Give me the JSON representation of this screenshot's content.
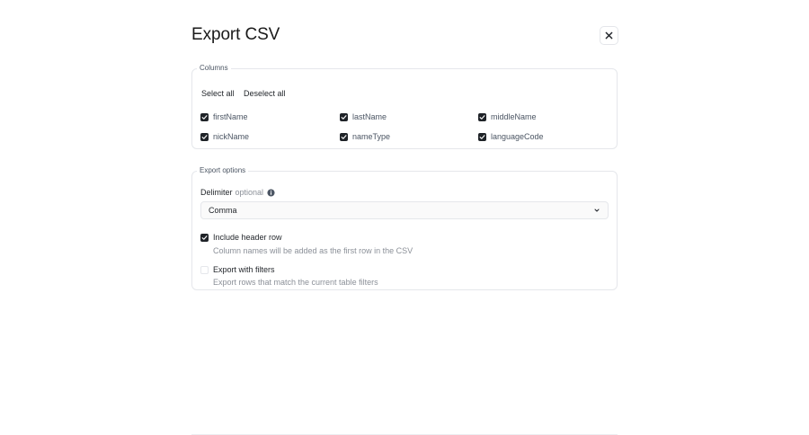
{
  "dialog": {
    "title": "Export CSV"
  },
  "columns": {
    "legend": "Columns",
    "select_all": "Select all",
    "deselect_all": "Deselect all",
    "items": [
      {
        "label": "firstName",
        "checked": true
      },
      {
        "label": "lastName",
        "checked": true
      },
      {
        "label": "middleName",
        "checked": true
      },
      {
        "label": "nickName",
        "checked": true
      },
      {
        "label": "nameType",
        "checked": true
      },
      {
        "label": "languageCode",
        "checked": true
      }
    ]
  },
  "export_options": {
    "legend": "Export options",
    "delimiter_label": "Delimiter",
    "delimiter_optional": "optional",
    "delimiter_value": "Comma",
    "include_header": {
      "title": "Include header row",
      "description": "Column names will be added as the first row in the CSV",
      "checked": true
    },
    "export_filters": {
      "title": "Export with filters",
      "description": "Export rows that match the current table filters",
      "checked": false
    }
  },
  "icons": [
    "close-icon",
    "checkmark-icon",
    "info-icon",
    "chevron-down-icon"
  ]
}
